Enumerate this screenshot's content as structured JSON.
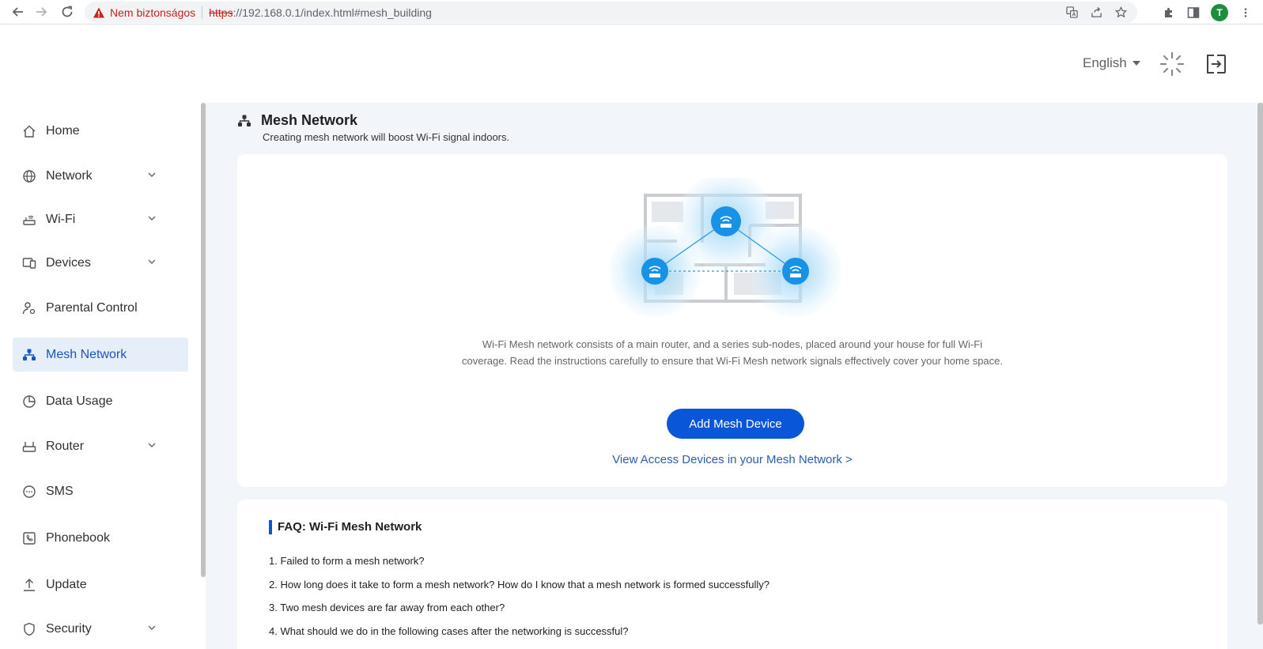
{
  "browser": {
    "insecure_label": "Nem biztonságos",
    "url_scheme": "https",
    "url_rest": "://192.168.0.1/index.html#mesh_building",
    "avatar_letter": "T"
  },
  "header": {
    "language": "English"
  },
  "sidebar": {
    "items": [
      {
        "label": "Home",
        "icon": "home-icon",
        "has_submenu": false
      },
      {
        "label": "Network",
        "icon": "globe-icon",
        "has_submenu": true
      },
      {
        "label": "Wi-Fi",
        "icon": "router-icon",
        "has_submenu": true
      },
      {
        "label": "Devices",
        "icon": "devices-icon",
        "has_submenu": true
      },
      {
        "label": "Parental Control",
        "icon": "parental-icon",
        "has_submenu": false
      },
      {
        "label": "Mesh Network",
        "icon": "mesh-icon",
        "has_submenu": false,
        "active": true
      },
      {
        "label": "Data Usage",
        "icon": "pie-icon",
        "has_submenu": false
      },
      {
        "label": "Router",
        "icon": "router-box-icon",
        "has_submenu": true
      },
      {
        "label": "SMS",
        "icon": "chat-icon",
        "has_submenu": false
      },
      {
        "label": "Phonebook",
        "icon": "phonebook-icon",
        "has_submenu": false
      },
      {
        "label": "Update",
        "icon": "upload-icon",
        "has_submenu": false
      },
      {
        "label": "Security",
        "icon": "shield-icon",
        "has_submenu": true
      }
    ]
  },
  "main": {
    "title": "Mesh Network",
    "subtitle": "Creating mesh network will boost Wi-Fi signal indoors.",
    "description": "Wi-Fi Mesh network consists of a main router, and a series sub-nodes, placed around your house for full Wi-Fi coverage. Read the instructions carefully to ensure that Wi-Fi Mesh network signals effectively cover your home space.",
    "add_button": "Add Mesh Device",
    "view_link": "View Access Devices in your Mesh Network >"
  },
  "faq": {
    "title": "FAQ: Wi-Fi Mesh Network",
    "items": [
      "1. Failed to form a mesh network?",
      "2. How long does it take to form a mesh network? How do I know that a mesh network is formed successfully?",
      "3. Two mesh devices are far away from each other?",
      "4. What should we do in the following cases after the networking is successful?"
    ]
  },
  "colors": {
    "accent": "#0a56d9",
    "active_bg": "#e6eefa",
    "main_bg": "#f2f5fa",
    "insecure": "#c5221f"
  }
}
